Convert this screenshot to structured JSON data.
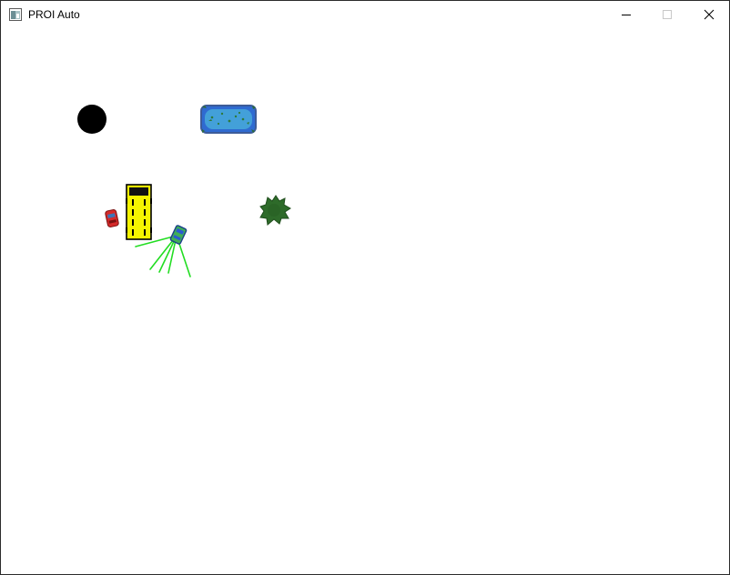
{
  "window": {
    "title": "PROI Auto",
    "icon": "app-window-icon",
    "controls": [
      "minimize-icon",
      "maximize-icon",
      "close-icon"
    ]
  },
  "scene": {
    "background_color": "#ffffff",
    "objects": [
      {
        "kind": "black-ball",
        "color": "#000000"
      },
      {
        "kind": "pond",
        "colors": [
          "#3a6fd0",
          "#3e95d6",
          "#2e7a3a"
        ]
      },
      {
        "kind": "bus",
        "color": "#f5f500"
      },
      {
        "kind": "red-car",
        "color": "#d42a2a"
      },
      {
        "kind": "player-car",
        "color": "#3fae56"
      },
      {
        "kind": "sensor-rays",
        "color": "#22dd22",
        "count": 5
      },
      {
        "kind": "tree",
        "color": "#2e6b2a"
      }
    ]
  }
}
